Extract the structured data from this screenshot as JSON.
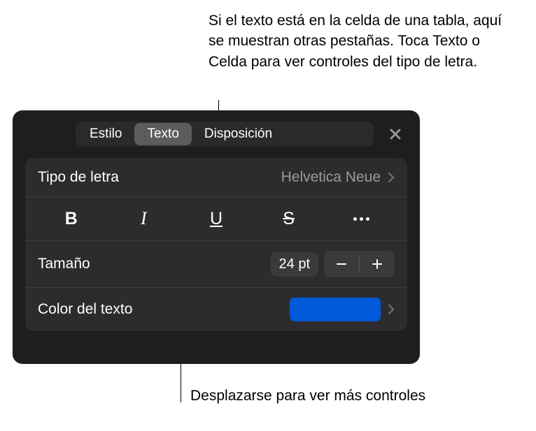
{
  "annotations": {
    "top": "Si el texto está en la celda de una tabla, aquí se muestran otras pestañas. Toca Texto o Celda para ver controles del tipo de letra.",
    "bottom": "Desplazarse para ver más controles"
  },
  "tabs": {
    "style": "Estilo",
    "text": "Texto",
    "layout": "Disposición"
  },
  "font": {
    "label": "Tipo de letra",
    "value": "Helvetica Neue"
  },
  "styleButtons": {
    "bold": "B",
    "italic": "I",
    "underline": "U",
    "strike": "S"
  },
  "size": {
    "label": "Tamaño",
    "value": "24 pt"
  },
  "textColor": {
    "label": "Color del texto",
    "value": "#0059d8"
  }
}
